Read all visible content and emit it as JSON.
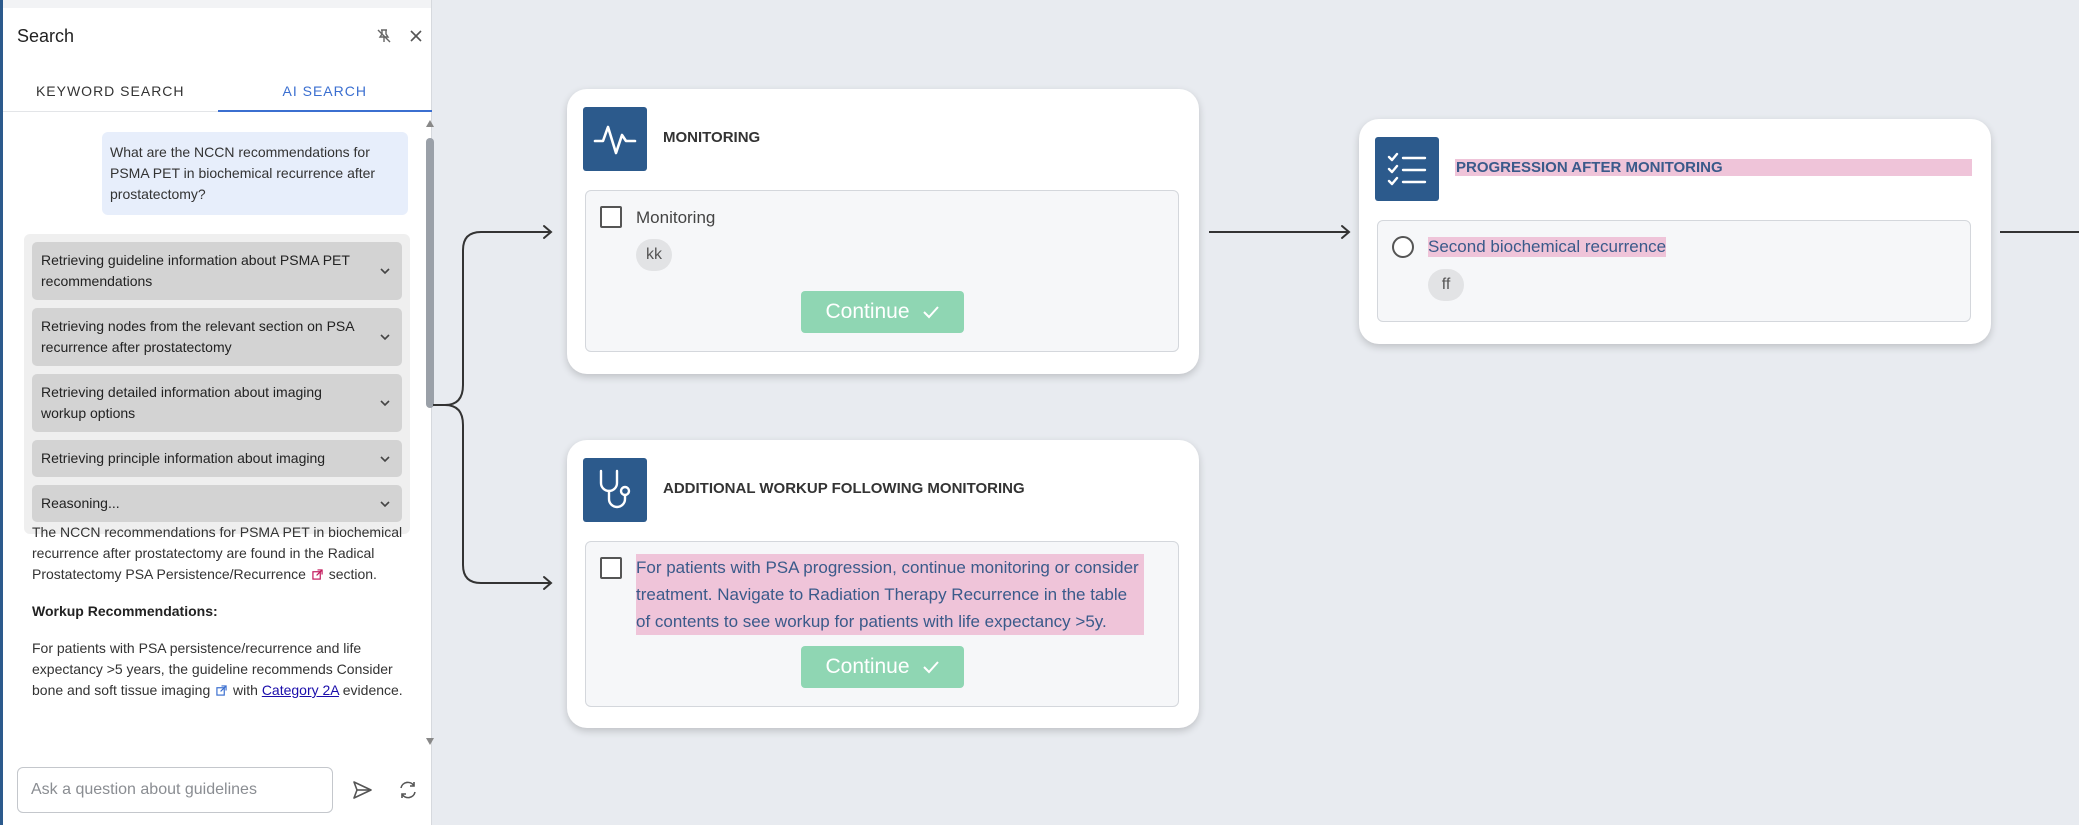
{
  "panel": {
    "title": "Search",
    "tabs": [
      {
        "label": "KEYWORD SEARCH",
        "active": false
      },
      {
        "label": "AI SEARCH",
        "active": true
      }
    ],
    "user_message": "What are the NCCN recommendations for PSMA PET in biochemical recurrence after prostatectomy?",
    "steps": [
      {
        "label": "Retrieving guideline information about PSMA PET recommendations"
      },
      {
        "label": "Retrieving nodes from the relevant section on PSA recurrence after prostatectomy"
      },
      {
        "label": "Retrieving detailed information about imaging workup options"
      },
      {
        "label": "Retrieving principle information about imaging"
      },
      {
        "label": "Reasoning..."
      }
    ],
    "answer": {
      "p1_text": "The NCCN recommendations for PSMA PET in biochemical recurrence after prostatectomy are found in the Radical Prostatectomy PSA Persistence/Recurrence",
      "p1_suffix": "section.",
      "heading": "Workup Recommendations:",
      "p2_text": "For patients with PSA persistence/recurrence and life expectancy >5 years, the guideline recommends Consider bone and soft tissue imaging",
      "p2_with": "with",
      "p2_link": "Category 2A",
      "p2_suffix": "evidence."
    },
    "input_placeholder": "Ask a question about guidelines",
    "input_value": ""
  },
  "nodes": {
    "monitoring": {
      "title": "MONITORING",
      "option_label": "Monitoring",
      "chip": "kk",
      "button": "Continue"
    },
    "progression": {
      "title": "PROGRESSION AFTER MONITORING",
      "option_label": "Second biochemical recurrence",
      "chip": "ff"
    },
    "additional": {
      "title": "ADDITIONAL WORKUP FOLLOWING MONITORING",
      "option_label": "For patients with PSA progression, continue monitoring or consider treatment. Navigate to Radiation Therapy Recurrence in the table of contents to see workup for patients with life expectancy >5y.",
      "button": "Continue"
    }
  },
  "colors": {
    "accent": "#3b6fd0",
    "node_icon_bg": "#2c5a8c",
    "continue_button": "#8fd6b3",
    "highlight": "#efc4d9"
  }
}
